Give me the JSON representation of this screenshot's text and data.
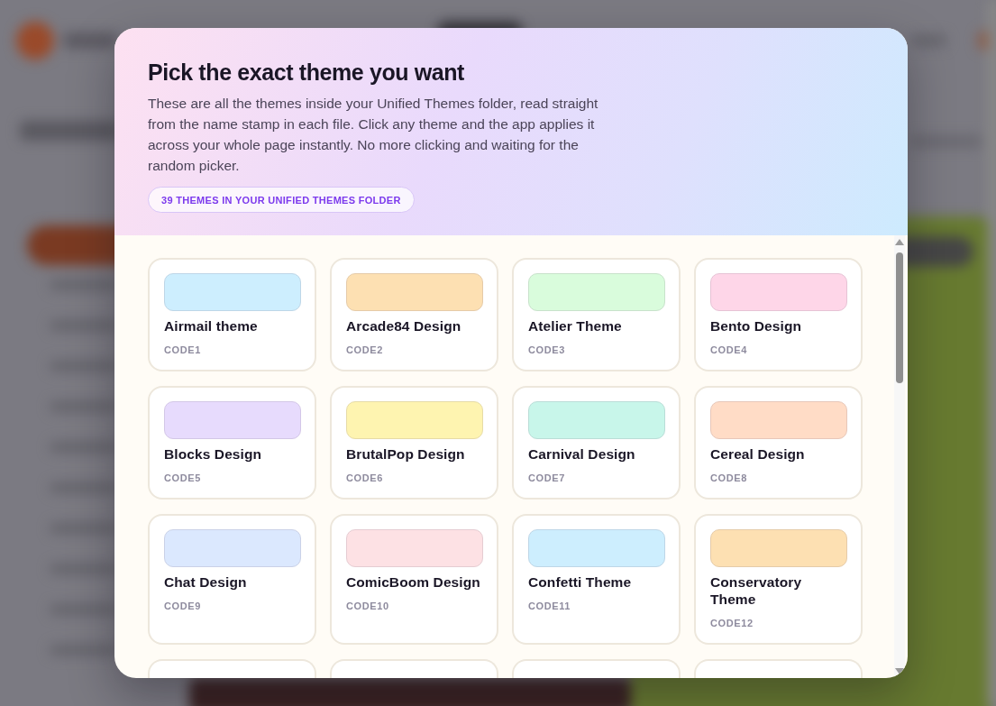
{
  "dialog": {
    "title": "Pick the exact theme you want",
    "description": "These are all the themes inside your Unified Themes folder, read straight from the name stamp in each file. Click any theme and the app applies it across your whole page instantly. No more clicking and waiting for the random picker.",
    "count_badge": "39 THEMES IN YOUR UNIFIED THEMES FOLDER",
    "themes": [
      {
        "name": "Airmail theme",
        "code": "CODE1",
        "color": "#cdeefe",
        "selected": false
      },
      {
        "name": "Arcade84 Design",
        "code": "CODE2",
        "color": "#fde0b2",
        "selected": false
      },
      {
        "name": "Atelier Theme",
        "code": "CODE3",
        "color": "#d9fcdc",
        "selected": false
      },
      {
        "name": "Bento Design",
        "code": "CODE4",
        "color": "#fed6e8",
        "selected": false
      },
      {
        "name": "Blocks Design",
        "code": "CODE5",
        "color": "#e7dbfd",
        "selected": false
      },
      {
        "name": "BrutalPop Design",
        "code": "CODE6",
        "color": "#fef4b0",
        "selected": false
      },
      {
        "name": "Carnival Design",
        "code": "CODE7",
        "color": "#c8f6ea",
        "selected": false
      },
      {
        "name": "Cereal Design",
        "code": "CODE8",
        "color": "#ffdcc6",
        "selected": false
      },
      {
        "name": "Chat Design",
        "code": "CODE9",
        "color": "#dbe8fe",
        "selected": false
      },
      {
        "name": "ComicBoom Design",
        "code": "CODE10",
        "color": "#fde1e4",
        "selected": false
      },
      {
        "name": "Confetti Theme",
        "code": "CODE11",
        "color": "#cdeefe",
        "selected": false
      },
      {
        "name": "Conservatory Theme",
        "code": "CODE12",
        "color": "#fde0b2",
        "selected": false
      }
    ],
    "next_row_peeking": true
  }
}
